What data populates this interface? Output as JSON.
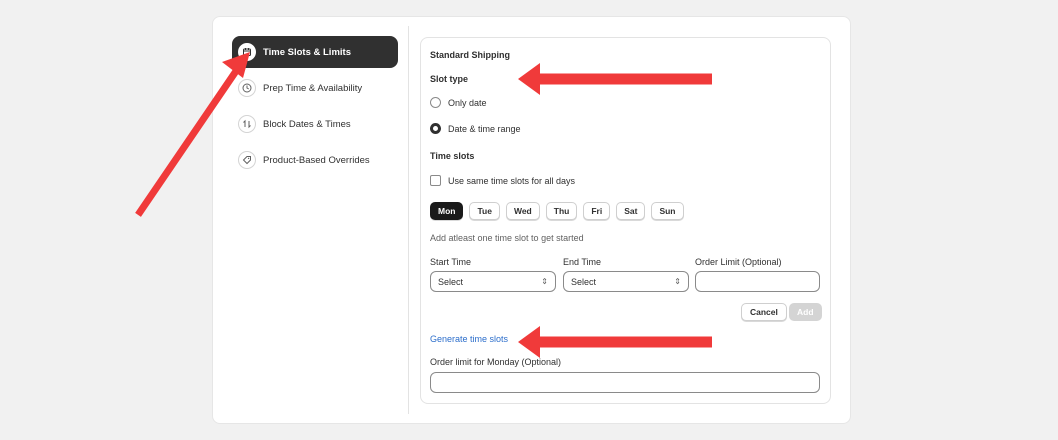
{
  "sidebar": {
    "items": [
      {
        "label": "Time Slots & Limits",
        "icon": "calendar-icon"
      },
      {
        "label": "Prep Time & Availability",
        "icon": "clock-icon"
      },
      {
        "label": "Block Dates & Times",
        "icon": "swap-icon"
      },
      {
        "label": "Product-Based Overrides",
        "icon": "tag-icon"
      }
    ]
  },
  "panel": {
    "title": "Standard Shipping",
    "slot_type_label": "Slot type",
    "radio_only_date": "Only date",
    "radio_date_time": "Date & time range",
    "time_slots_label": "Time slots",
    "same_slots_label": "Use same time slots for all days",
    "days": [
      "Mon",
      "Tue",
      "Wed",
      "Thu",
      "Fri",
      "Sat",
      "Sun"
    ],
    "hint": "Add atleast one time slot to get started",
    "start_time_label": "Start Time",
    "end_time_label": "End Time",
    "order_limit_label": "Order Limit (Optional)",
    "start_time_value": "Select",
    "end_time_value": "Select",
    "cancel_label": "Cancel",
    "add_label": "Add",
    "generate_link": "Generate time slots",
    "monday_limit_label": "Order limit for Monday (Optional)"
  },
  "colors": {
    "accent": "#303030",
    "link": "#2c6ecb",
    "arrow": "#f03a3a"
  }
}
